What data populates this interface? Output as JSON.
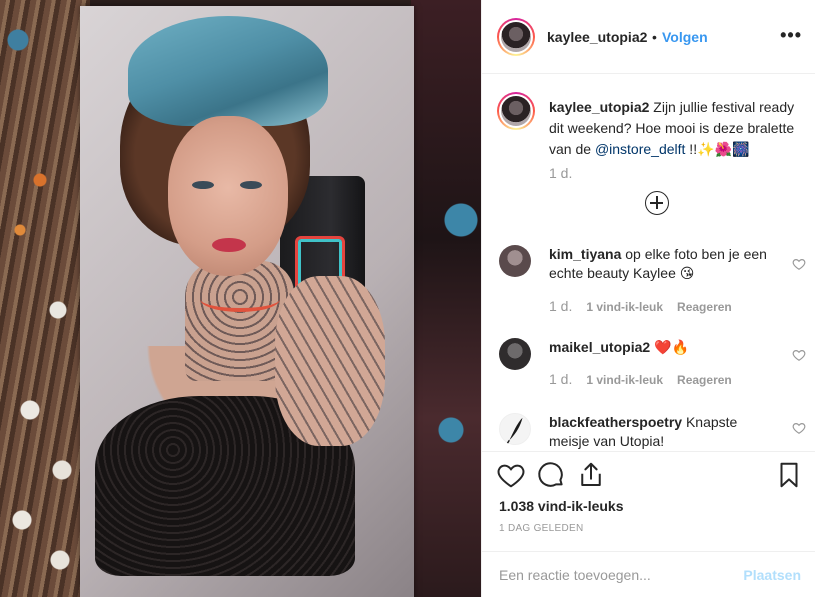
{
  "post": {
    "username": "kaylee_utopia2",
    "separator": "•",
    "follow_label": "Volgen",
    "more_icon": "more-options-icon",
    "more_glyph": "•••"
  },
  "caption": {
    "username": "kaylee_utopia2",
    "text_before_mention": " Zijn jullie festival ready dit weekend? Hoe mooi is deze bralette van de ",
    "mention": "@instore_delft",
    "text_after_mention": " !!✨🌺🎆",
    "time": "1 d."
  },
  "comments": [
    {
      "username": "kim_tiyana",
      "text": " op elke foto ben je een echte beauty Kaylee 😘",
      "time": "1 d.",
      "likes": "1 vind-ik-leuk",
      "reply": "Reageren",
      "avatar_color": "#6d5a5c"
    },
    {
      "username": "maikel_utopia2",
      "text": " ❤️🔥",
      "time": "1 d.",
      "likes": "1 vind-ik-leuk",
      "reply": "Reageren",
      "avatar_color": "#3d3a3b"
    },
    {
      "username": "blackfeatherspoetry",
      "text": " Knapste meisje van Utopia!",
      "avatar_color": "#f4f4f4"
    }
  ],
  "actions": {
    "like_icon": "heart-outline-icon",
    "comment_icon": "comment-bubble-icon",
    "share_icon": "share-icon",
    "save_icon": "bookmark-icon",
    "likes_count": "1.038 vind-ik-leuks",
    "posted": "1 DAG GELEDEN"
  },
  "add_comment": {
    "placeholder": "Een reactie toevoegen...",
    "post_label": "Plaatsen",
    "post_color": "#b2dffc"
  },
  "colors": {
    "accent": "#3897f0",
    "muted": "#999999",
    "text": "#262626"
  }
}
